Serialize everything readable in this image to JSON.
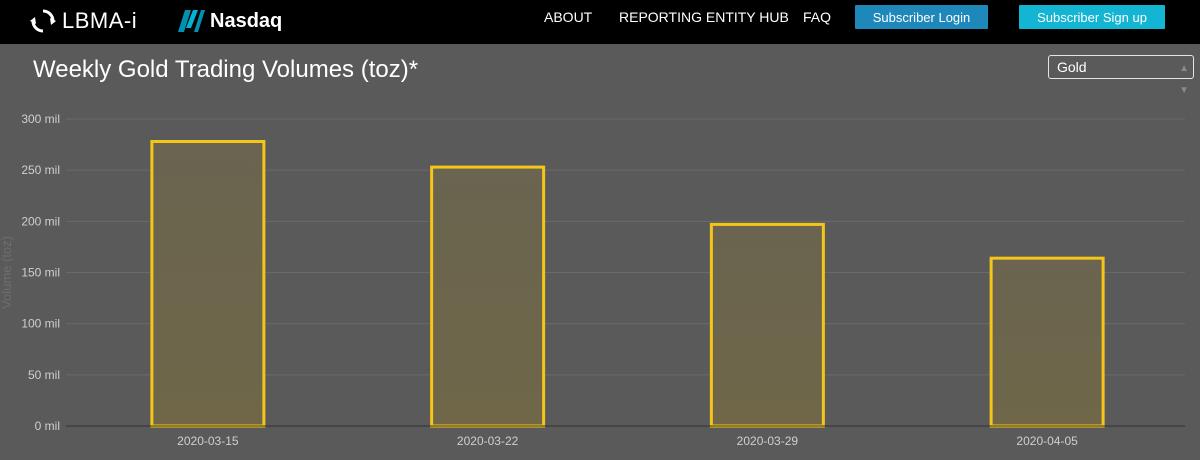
{
  "header": {
    "lbma_logo_text": "LBMA-i",
    "nasdaq_logo_text": "Nasdaq",
    "nav": [
      "ABOUT",
      "REPORTING ENTITY HUB",
      "FAQ"
    ],
    "login_label": "Subscriber Login",
    "signup_label": "Subscriber Sign up"
  },
  "page": {
    "title": "Weekly Gold Trading Volumes (toz)*",
    "metal_select": "Gold"
  },
  "chart_data": {
    "type": "bar",
    "categories": [
      "2020-03-15",
      "2020-03-22",
      "2020-03-29",
      "2020-04-05"
    ],
    "values": [
      278,
      253,
      197,
      164
    ],
    "unit": "mil",
    "ylabel": "Volume (toz)",
    "ylim": [
      0,
      300
    ],
    "yticks": [
      "0 mil",
      "50 mil",
      "100 mil",
      "150 mil",
      "200 mil",
      "250 mil",
      "300 mil"
    ],
    "grid": true,
    "bar_color": "#f5c518"
  }
}
